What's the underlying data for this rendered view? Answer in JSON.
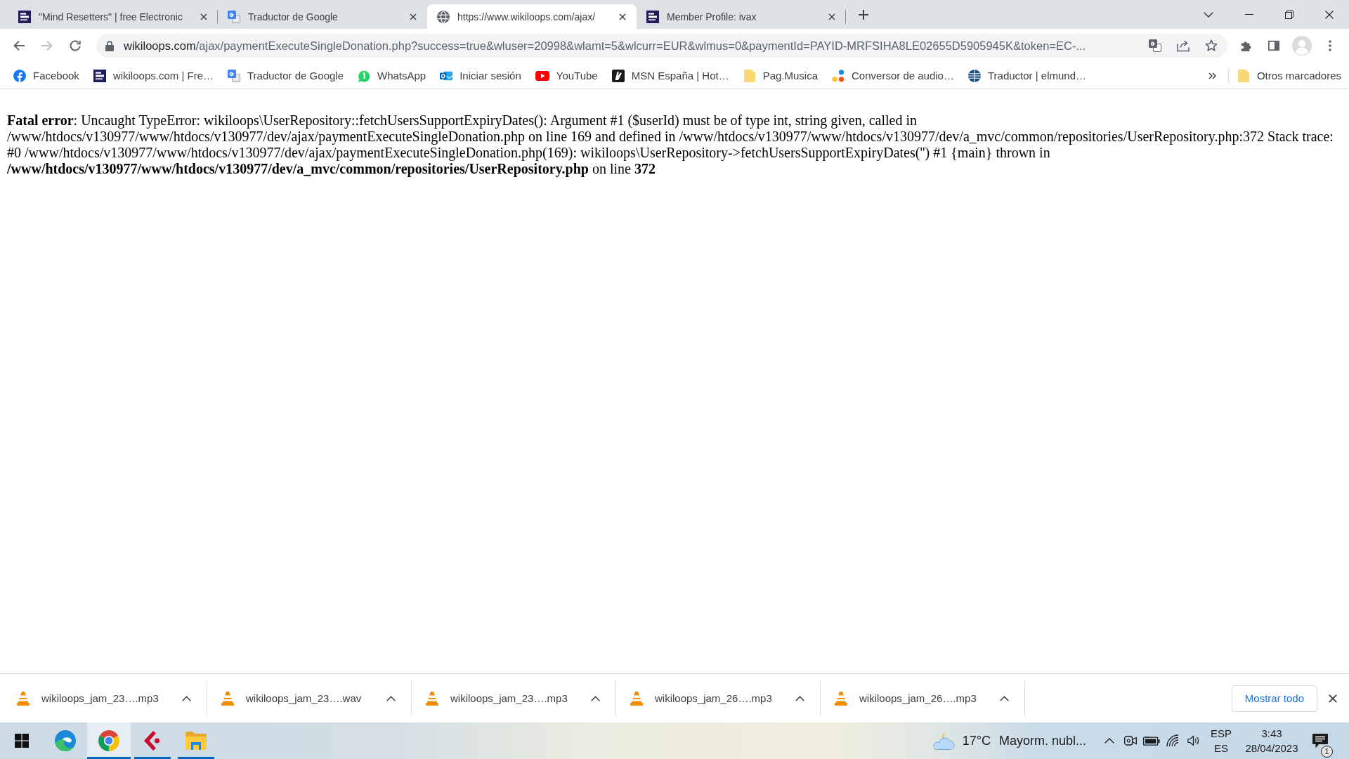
{
  "tabs": [
    {
      "title": "\"Mind Resetters\" | free Electronic",
      "kind": "logo",
      "selected": false
    },
    {
      "title": "Traductor de Google",
      "kind": "translate",
      "selected": false
    },
    {
      "title": "https://www.wikiloops.com/ajax/",
      "kind": "globe",
      "selected": true
    },
    {
      "title": "Member Profile: ivax",
      "kind": "logo",
      "selected": false
    }
  ],
  "navigation": {
    "back_enabled": true,
    "forward_enabled": false
  },
  "address_bar": {
    "host": "wikiloops.com",
    "path": "/ajax/paymentExecuteSingleDonation.php?success=true&wluser=20998&wlamt=5&wlcurr=EUR&wlmus=0&paymentId=PAYID-MRFSIHA8LE02655D5905945K&token=EC-..."
  },
  "bookmarks": [
    {
      "label": "Facebook",
      "kind": "facebook"
    },
    {
      "label": "wikiloops.com | Fre…",
      "kind": "logo"
    },
    {
      "label": "Traductor de Google",
      "kind": "translate"
    },
    {
      "label": "WhatsApp",
      "kind": "chat"
    },
    {
      "label": "Iniciar sesión",
      "kind": "mail"
    },
    {
      "label": "YouTube",
      "kind": "play"
    },
    {
      "label": "MSN España | Hot…",
      "kind": "mark"
    },
    {
      "label": "Pag.Musica",
      "kind": "folder"
    },
    {
      "label": "Conversor de audio…",
      "kind": "dots"
    },
    {
      "label": "Traductor | elmund…",
      "kind": "globe"
    }
  ],
  "other_bookmarks": "Otros marcadores",
  "page": {
    "error": "**Fatal error**: Uncaught TypeError: wikiloops\\UserRepository::fetchUsersSupportExpiryDates(): Argument #1 ($userId) must be of type int, string given, called in /www/htdocs/v130977/www/htdocs/v130977/dev/ajax/paymentExecuteSingleDonation.php on line 169 and defined in /www/htdocs/v130977/www/htdocs/v130977/dev/a_mvc/common/repositories/UserRepository.php:372 Stack trace: #0 /www/htdocs/v130977/www/htdocs/v130977/dev/ajax/paymentExecuteSingleDonation.php(169): wikiloops\\UserRepository->fetchUsersSupportExpiryDates('') #1 {main} thrown in **/www/htdocs/v130977/www/htdocs/v130977/dev/a_mvc/common/repositories/UserRepository.php** on line **372**"
  },
  "downloads": {
    "items": [
      {
        "filename": "wikiloops_jam_23….mp3"
      },
      {
        "filename": "wikiloops_jam_23….wav"
      },
      {
        "filename": "wikiloops_jam_23….mp3"
      },
      {
        "filename": "wikiloops_jam_26….mp3"
      },
      {
        "filename": "wikiloops_jam_26….mp3"
      }
    ],
    "show_all": "Mostrar todo"
  },
  "taskbar": {
    "apps": [
      {
        "kind": "edge",
        "running": false,
        "selected": false
      },
      {
        "kind": "chrome",
        "running": true,
        "selected": true
      },
      {
        "kind": "logo",
        "running": true,
        "selected": false
      },
      {
        "kind": "folder",
        "running": true,
        "selected": false
      }
    ],
    "weather": {
      "temperature": "17°C",
      "condition": "Mayorm. nubl..."
    },
    "language": {
      "input": "ESP",
      "layout": "ES"
    },
    "clock": {
      "time": "3:43",
      "date": "28/04/2023"
    },
    "notification_count": "1"
  }
}
